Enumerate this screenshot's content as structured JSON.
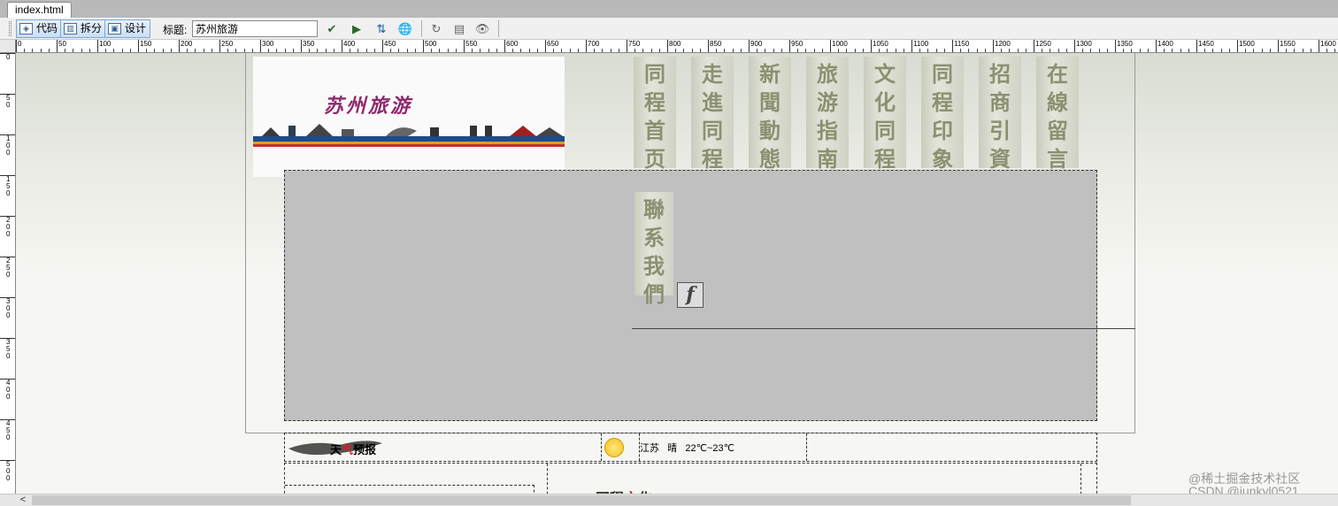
{
  "document_tab": {
    "label": "index.html"
  },
  "toolbar": {
    "view_buttons": [
      {
        "label": "代码",
        "icon": "code-view-icon"
      },
      {
        "label": "拆分",
        "icon": "split-view-icon"
      },
      {
        "label": "设计",
        "icon": "design-view-icon"
      }
    ],
    "title_label": "标题:",
    "title_value": "苏州旅游",
    "tools": [
      {
        "icon": "validate-markup-icon",
        "glyph": "✔"
      },
      {
        "icon": "check-browser-icon",
        "glyph": "▶"
      },
      {
        "icon": "file-management-icon",
        "glyph": "⇅"
      },
      {
        "icon": "preview-browser-icon",
        "glyph": "🌐"
      },
      {
        "icon": "refresh-icon",
        "glyph": "↻"
      },
      {
        "icon": "view-options-icon",
        "glyph": "▤"
      },
      {
        "icon": "visual-aids-icon",
        "glyph": "👁"
      }
    ]
  },
  "ruler": {
    "h_labels": [
      "0",
      "50",
      "100",
      "150",
      "200",
      "250",
      "300",
      "350",
      "400",
      "450",
      "500",
      "550",
      "600",
      "650",
      "700",
      "750",
      "800",
      "850",
      "900",
      "950",
      "1000",
      "1050",
      "1100",
      "1150",
      "1200",
      "1250",
      "1300",
      "1350",
      "1400",
      "1450",
      "1500",
      "1550",
      "1600"
    ],
    "v_labels": [
      "0",
      "50",
      "100",
      "150",
      "200",
      "250",
      "300",
      "350",
      "400",
      "450",
      "500"
    ]
  },
  "page": {
    "logo_text": "苏州旅游",
    "nav": [
      "同程首页",
      "走進同程",
      "新聞動態",
      "旅游指南",
      "文化同程",
      "同程印象",
      "招商引資",
      "在線留言"
    ],
    "nav_contact": "聯系我們",
    "flash_placeholder": "f",
    "weather": {
      "title_part1": "天",
      "title_part2": "气",
      "title_part3": "预报",
      "icon": "sun-icon",
      "text": "江苏   晴   22℃~23℃"
    },
    "culture_label_part1": "同程",
    "culture_label_part2": "文",
    "culture_label_part3": "化"
  },
  "watermark": "@稀土掘金技术社区\nCSDN @junkyl0521",
  "colors": {
    "toolbar_active": "#c9def5",
    "placeholder_gray": "#c0c0c0",
    "nav_text": "#8b9070",
    "logo_text": "#8e2a6e"
  }
}
